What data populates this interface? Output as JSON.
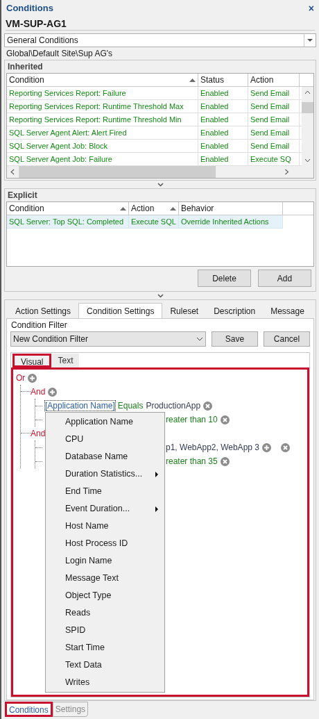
{
  "panel": {
    "title": "Conditions",
    "close": "×"
  },
  "server": "VM-SUP-AG1",
  "condition_type": {
    "value": "General Conditions"
  },
  "path": "Global\\Default Site\\Sup AG's",
  "inherited": {
    "title": "Inherited",
    "columns": [
      {
        "label": "Condition",
        "sorted": true
      },
      {
        "label": "Status",
        "sorted": false
      },
      {
        "label": "Action",
        "sorted": false
      }
    ],
    "rows": [
      [
        "Reporting Services Report: Failure",
        "Enabled",
        "Send Email"
      ],
      [
        "Reporting Services Report: Runtime Threshold Max",
        "Enabled",
        "Send Email"
      ],
      [
        "Reporting Services Report: Runtime Threshold Min",
        "Enabled",
        "Send Email"
      ],
      [
        "SQL Server Agent Alert: Alert Fired",
        "Enabled",
        "Send Email"
      ],
      [
        "SQL Server Agent Job: Block",
        "Enabled",
        "Send Email"
      ],
      [
        "SQL Server Agent Job: Failure",
        "Enabled",
        "Execute SQ"
      ]
    ]
  },
  "explicit": {
    "title": "Explicit",
    "columns": [
      {
        "label": "Condition",
        "sorted": true
      },
      {
        "label": "Action",
        "sorted": true
      },
      {
        "label": "Behavior",
        "sorted": false
      }
    ],
    "rows": [
      {
        "cells": [
          "SQL Server: Top SQL: Completed",
          "Execute SQL",
          "Override Inherited Actions"
        ],
        "selected": true
      }
    ],
    "buttons": [
      "Delete",
      "Add"
    ]
  },
  "tabs": [
    {
      "label": "Action Settings",
      "selected": false
    },
    {
      "label": "Condition Settings",
      "selected": true
    },
    {
      "label": "Ruleset",
      "selected": false
    },
    {
      "label": "Description",
      "selected": false
    },
    {
      "label": "Message",
      "selected": false
    }
  ],
  "condition_filter": {
    "label": "Condition Filter",
    "value": "New Condition Filter",
    "buttons": [
      "Save",
      "Cancel"
    ]
  },
  "view_tabs": [
    {
      "label": "Visual",
      "selected": true,
      "highlighted": true
    },
    {
      "label": "Text",
      "selected": false,
      "highlighted": false
    }
  ],
  "visual_panel": {
    "highlighted": true
  },
  "tree": {
    "kind": "group",
    "label": "Or",
    "addable": true,
    "children": [
      {
        "kind": "group",
        "label": "And",
        "addable": true,
        "children": [
          {
            "kind": "condition",
            "field": "[Application Name]",
            "operator": "Equals",
            "value": "ProductionApp",
            "focused": true,
            "addable": false,
            "removable": true
          },
          {
            "kind": "condition",
            "operator": "reater than 10",
            "addable": false,
            "removable": true
          }
        ]
      },
      {
        "kind": "group",
        "label": "And",
        "addable": false,
        "children": [
          {
            "kind": "condition",
            "value": "p1, WebApp2, WebApp 3",
            "addable": true,
            "removable": true
          },
          {
            "kind": "condition",
            "operator": "reater than 35",
            "addable": false,
            "removable": true
          }
        ]
      }
    ]
  },
  "field_menu": [
    {
      "label": "Application Name",
      "submenu": false
    },
    {
      "label": "CPU",
      "submenu": false
    },
    {
      "label": "Database Name",
      "submenu": false
    },
    {
      "label": "Duration Statistics...",
      "submenu": true
    },
    {
      "label": "End Time",
      "submenu": false
    },
    {
      "label": "Event Duration...",
      "submenu": true
    },
    {
      "label": "Host Name",
      "submenu": false
    },
    {
      "label": "Host Process ID",
      "submenu": false
    },
    {
      "label": "Login Name",
      "submenu": false
    },
    {
      "label": "Message Text",
      "submenu": false
    },
    {
      "label": "Object Type",
      "submenu": false
    },
    {
      "label": "Reads",
      "submenu": false
    },
    {
      "label": "SPID",
      "submenu": false
    },
    {
      "label": "Start Time",
      "submenu": false
    },
    {
      "label": "Text Data",
      "submenu": false
    },
    {
      "label": "Writes",
      "submenu": false
    }
  ],
  "bottom_tabs": [
    {
      "label": "Conditions",
      "selected": true,
      "highlighted": true
    },
    {
      "label": "Settings",
      "selected": false,
      "highlighted": false
    }
  ]
}
